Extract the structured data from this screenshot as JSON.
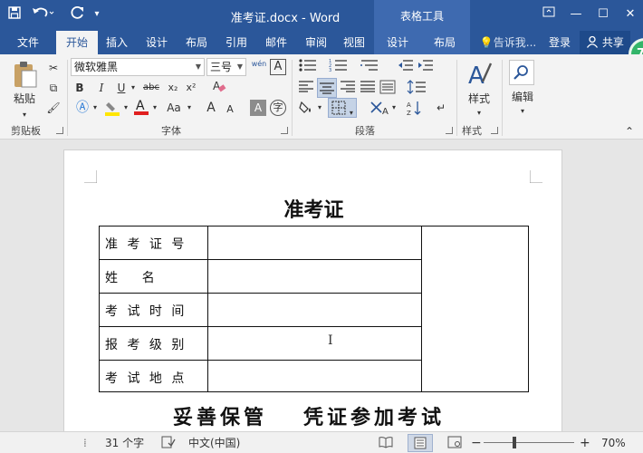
{
  "titlebar": {
    "title": "准考证.docx - Word",
    "context_tab_group": "表格工具",
    "save_icon": "save-icon",
    "undo_icon": "undo-icon",
    "redo_icon": "redo-icon"
  },
  "tabs": [
    {
      "label": "文件"
    },
    {
      "label": "开始"
    },
    {
      "label": "插入"
    },
    {
      "label": "设计"
    },
    {
      "label": "布局"
    },
    {
      "label": "引用"
    },
    {
      "label": "邮件"
    },
    {
      "label": "审阅"
    },
    {
      "label": "视图"
    },
    {
      "label": "设计"
    },
    {
      "label": "布局"
    }
  ],
  "tell_me": "告诉我...",
  "signin": "登录",
  "share": "共享",
  "ribbon": {
    "clipboard": {
      "label": "剪贴板",
      "paste": "粘贴"
    },
    "font": {
      "label": "字体",
      "font_name": "微软雅黑",
      "font_size": "三号",
      "bold": "B",
      "italic": "I",
      "underline": "U",
      "strike": "abc",
      "subscript": "x₂",
      "superscript": "x²",
      "grow": "A",
      "shrink": "A",
      "case": "Aa",
      "char_border": "A",
      "wen": "wén",
      "char_box": "A"
    },
    "paragraph": {
      "label": "段落"
    },
    "styles": {
      "label": "样式",
      "button": "样式"
    },
    "editing": {
      "button": "编辑"
    }
  },
  "document": {
    "heading": "准考证",
    "rows": [
      {
        "label": "准 考 证 号"
      },
      {
        "label": "姓      名"
      },
      {
        "label": "考 试 时 间"
      },
      {
        "label": "报 考 级 别"
      },
      {
        "label": "考 试 地 点"
      }
    ],
    "footer_left": "妥善保管",
    "footer_right": "凭证参加考试"
  },
  "status": {
    "words": "31 个字",
    "language": "中文(中国)",
    "zoom": "70%"
  },
  "avatar_badge": "76"
}
